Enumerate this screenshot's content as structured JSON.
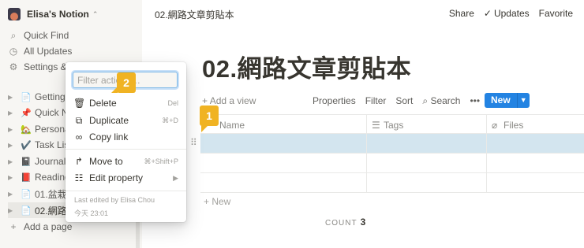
{
  "workspace": {
    "name": "Elisa's Notion"
  },
  "sidebar": {
    "nav": [
      {
        "label": "Quick Find",
        "icon": "search-icon"
      },
      {
        "label": "All Updates",
        "icon": "clock-icon"
      },
      {
        "label": "Settings &",
        "icon": "gear-icon"
      }
    ],
    "pages": [
      {
        "label": "Getting Started",
        "emoji": "📄"
      },
      {
        "label": "Quick Note",
        "emoji": "📌"
      },
      {
        "label": "Personal Home",
        "emoji": "🏡"
      },
      {
        "label": "Task List",
        "emoji": "✔️"
      },
      {
        "label": "Journal",
        "emoji": "📓"
      },
      {
        "label": "Reading List",
        "emoji": "📕"
      },
      {
        "label": "01.盆栽",
        "emoji": "📄"
      },
      {
        "label": "02.網路文章剪貼本",
        "emoji": "📄"
      }
    ],
    "add_page": "Add a page"
  },
  "topbar": {
    "title": "02.網路文章剪貼本",
    "share": "Share",
    "updates": "Updates",
    "favorite": "Favorite"
  },
  "page": {
    "title": "02.網路文章剪貼本",
    "add_view": "Add a view",
    "toolbar": {
      "properties": "Properties",
      "filter": "Filter",
      "sort": "Sort",
      "search": "Search",
      "more": "•••",
      "new": "New"
    },
    "columns": [
      "Name",
      "Tags",
      "Files"
    ],
    "new_row": "New",
    "count_label": "COUNT",
    "count_value": "3"
  },
  "menu": {
    "filter_placeholder": "Filter actions…",
    "items": [
      {
        "label": "Delete",
        "shortcut": "Del",
        "icon": "trash-icon"
      },
      {
        "label": "Duplicate",
        "shortcut": "⌘+D",
        "icon": "duplicate-icon"
      },
      {
        "label": "Copy link",
        "shortcut": "",
        "icon": "link-icon"
      },
      {
        "label": "Move to",
        "shortcut": "⌘+Shift+P",
        "icon": "move-arrow-icon"
      },
      {
        "label": "Edit property",
        "shortcut": "▶",
        "icon": "list-icon"
      }
    ],
    "last_edited": "Last edited by Elisa Chou",
    "timestamp": "今天 23:01"
  },
  "callouts": {
    "one": "1",
    "two": "2"
  },
  "colors": {
    "accent": "#2383e2",
    "callout": "#f0b323",
    "selection": "#d3e5ef"
  }
}
